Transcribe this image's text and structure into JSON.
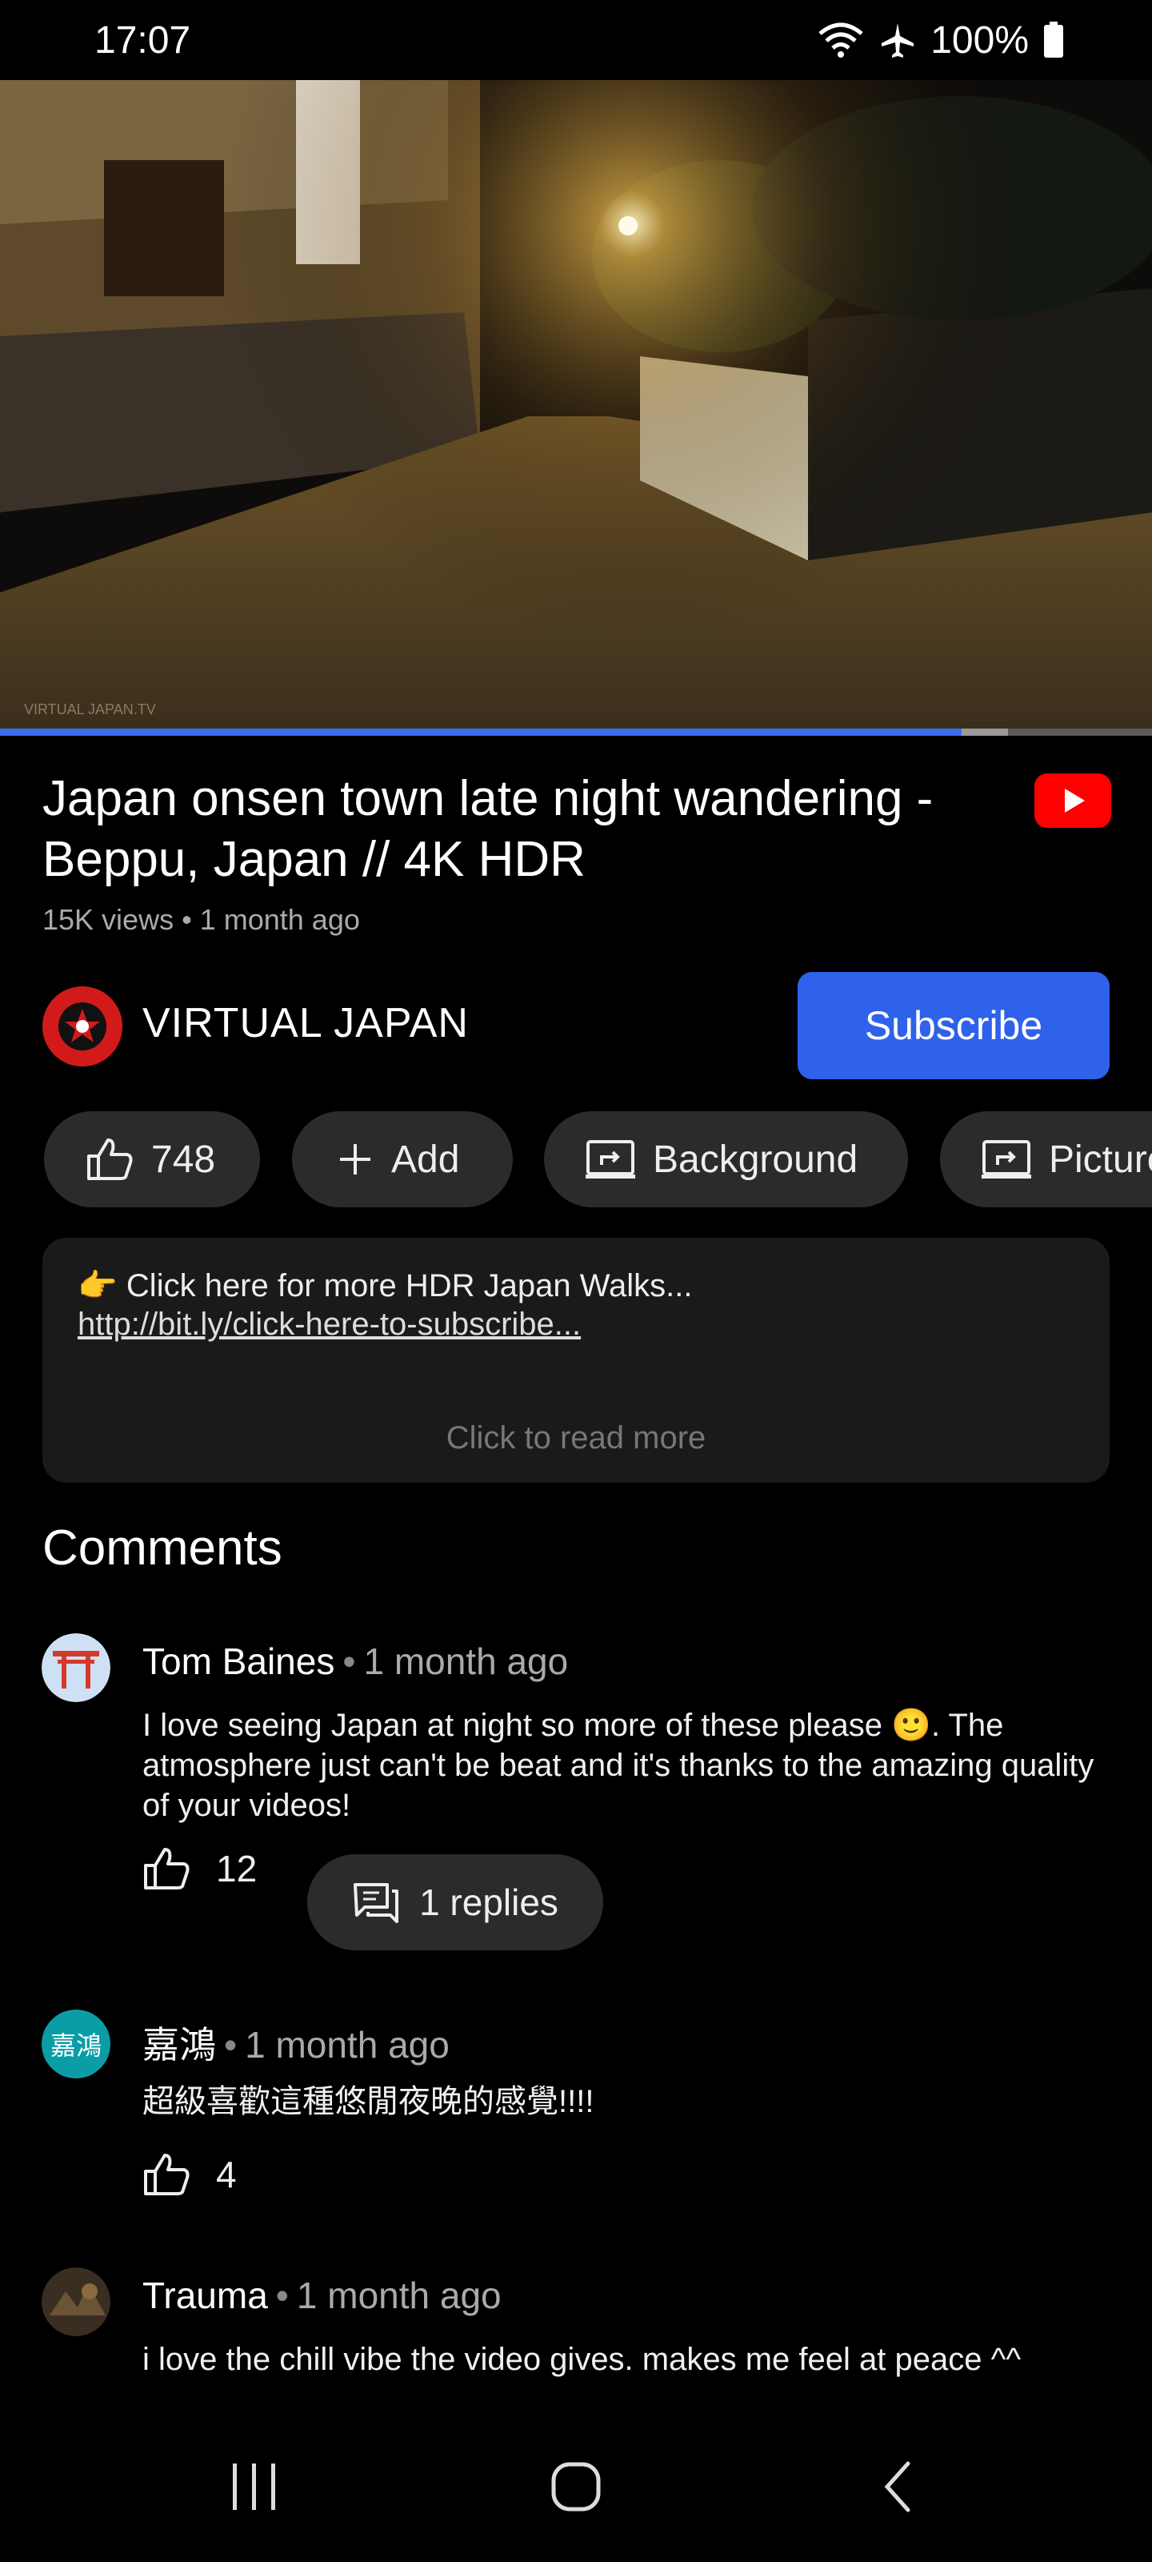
{
  "status_bar": {
    "time": "17:07",
    "battery": "100%",
    "icons": [
      "wifi-icon",
      "airplane-mode-icon",
      "battery-icon"
    ]
  },
  "video": {
    "thumbnail": "night-street-scene",
    "progress_fraction": 0.835,
    "buffered_fraction": 0.875
  },
  "details": {
    "title": "Japan onsen town late night wandering - Beppu, Japan // 4K HDR",
    "views": "15K views",
    "separator": "•",
    "age": "1 month ago"
  },
  "channel": {
    "name": "VIRTUAL JAPAN",
    "subscribe_label": "Subscribe"
  },
  "actions": {
    "like_count": "748",
    "add_label": "Add",
    "background_label": "Background",
    "picture_label": "Picture"
  },
  "description": {
    "line1": "👉 Click here for more HDR Japan Walks...",
    "link": "http://bit.ly/click-here-to-subscribe...",
    "read_more": "Click to read more"
  },
  "comments": {
    "heading": "Comments",
    "items": [
      {
        "author": "Tom Baines",
        "time": "1 month ago",
        "text": "I love seeing Japan at night so more of these please 🙂. The atmosphere just can't be beat and it's thanks to the amazing quality of your videos!",
        "likes": "12",
        "replies": "1 replies",
        "avatar": "torii-gate-avatar"
      },
      {
        "author": "嘉鴻",
        "time": "1 month ago",
        "text": "超級喜歡這種悠閒夜晚的感覺!!!!",
        "likes": "4",
        "avatar_text": "嘉鴻"
      },
      {
        "author": "Trauma",
        "time": "1 month ago",
        "text": "i love the chill vibe the video gives. makes me feel at peace ^^",
        "avatar": "photo-avatar"
      }
    ]
  },
  "colors": {
    "accent": "#2f62ea",
    "youtube_red": "#ff0000",
    "chip_bg": "#2b2b2b",
    "progress": "#3d6df2"
  }
}
